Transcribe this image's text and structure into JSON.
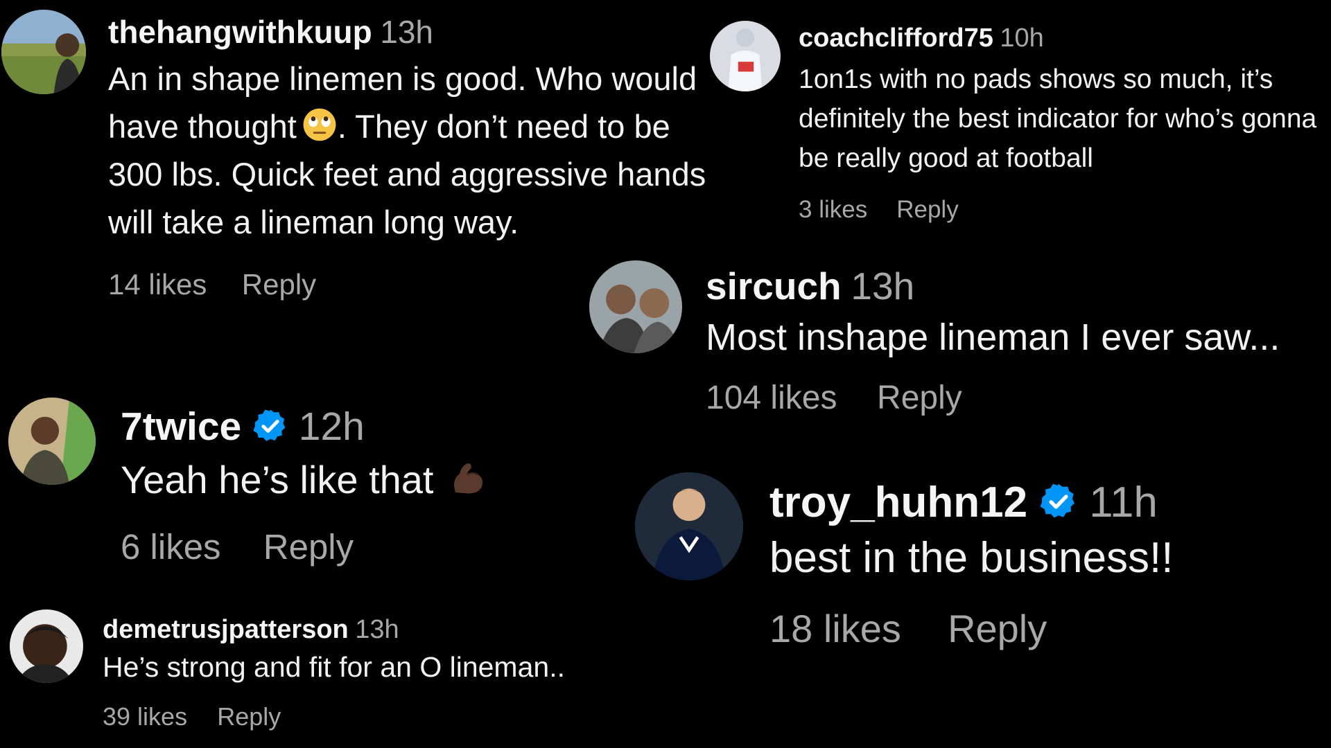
{
  "comments": [
    {
      "username": "thehangwithkuup",
      "time": "13h",
      "text": "An in shape linemen is good. Who would have thought",
      "text_after_emoji": ". They don’t need to be 300 lbs. Quick feet and aggressive hands will take a lineman long way.",
      "emoji": "face-with-rolling-eyes",
      "likes": "14 likes",
      "reply": "Reply"
    },
    {
      "username": "coachclifford75",
      "time": "10h",
      "text": "1on1s with no pads shows so much, it’s definitely the best indicator for who’s gonna be really good at football",
      "likes": "3 likes",
      "reply": "Reply"
    },
    {
      "username": "sircuch",
      "time": "13h",
      "text": "Most inshape lineman I ever saw...",
      "likes": "104 likes",
      "reply": "Reply"
    },
    {
      "username": "7twice",
      "verified": true,
      "time": "12h",
      "text": "Yeah he’s like that",
      "emoji": "flexed-biceps",
      "likes": "6 likes",
      "reply": "Reply"
    },
    {
      "username": "troy_huhn12",
      "verified": true,
      "time": "11h",
      "text": "best in the business!!",
      "likes": "18 likes",
      "reply": "Reply"
    },
    {
      "username": "demetrusjpatterson",
      "time": "13h",
      "text": "He’s strong and fit for an O lineman..",
      "likes": "39 likes",
      "reply": "Reply"
    }
  ],
  "colors": {
    "background": "#000000",
    "username": "#f5f5f5",
    "muted": "#a8a8a8",
    "verified": "#0095f6"
  }
}
